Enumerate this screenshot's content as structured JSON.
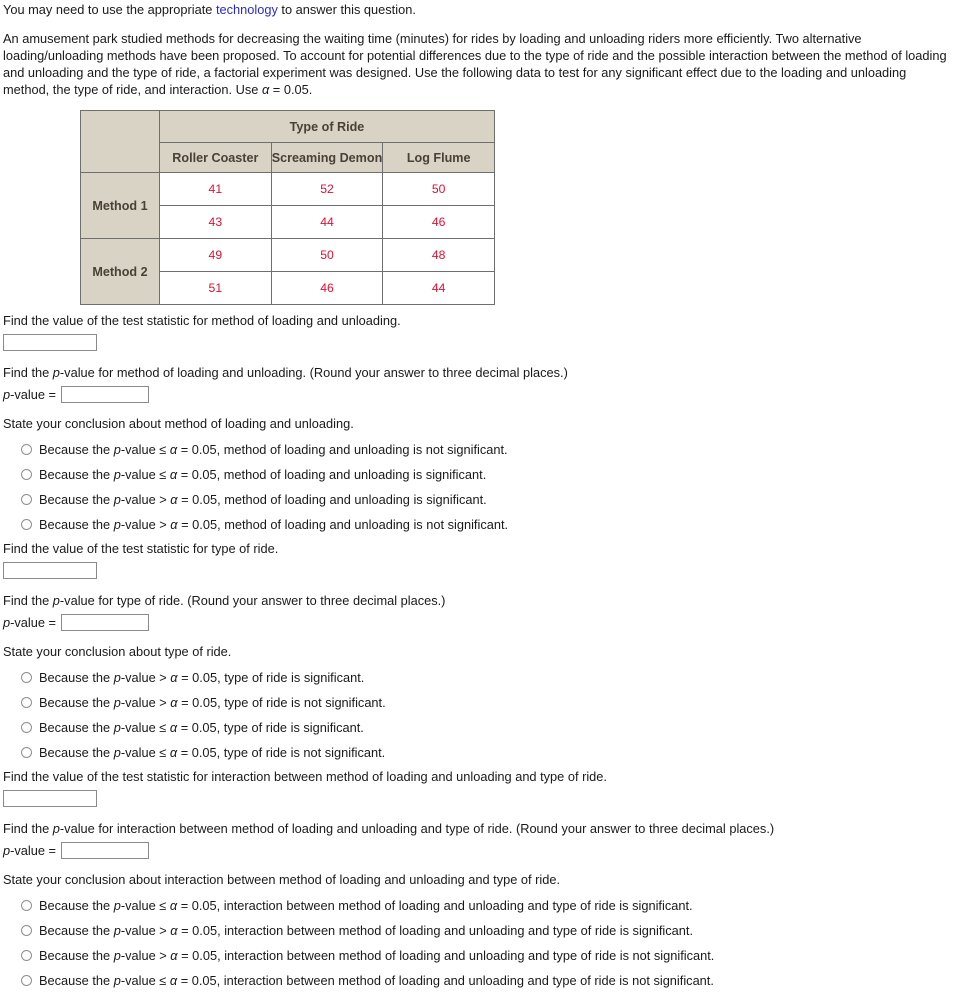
{
  "intro": {
    "prefix": "You may need to use the appropriate ",
    "link_label": "technology",
    "suffix": " to answer this question."
  },
  "problem": {
    "text": "An amusement park studied methods for decreasing the waiting time (minutes) for rides by loading and unloading riders more efficiently. Two alternative loading/unloading methods have been proposed. To account for potential differences due to the type of ride and the possible interaction between the method of loading and unloading and the type of ride, a factorial experiment was designed. Use the following data to test for any significant effect due to the loading and unloading method, the type of ride, and interaction. Use ",
    "alpha_symbol": "α",
    "alpha_statement": " = 0.05."
  },
  "table": {
    "corner_label": "",
    "group_header": "Type of Ride",
    "column_headers": [
      "Roller Coaster",
      "Screaming Demon",
      "Log Flume"
    ],
    "rows": [
      {
        "label": "Method 1",
        "values": [
          [
            "41",
            "52",
            "50"
          ],
          [
            "43",
            "44",
            "46"
          ]
        ]
      },
      {
        "label": "Method 2",
        "values": [
          [
            "49",
            "50",
            "48"
          ],
          [
            "51",
            "46",
            "44"
          ]
        ]
      }
    ]
  },
  "questions": [
    {
      "statistic_prompt": "Find the value of the test statistic for method of loading and unloading.",
      "statistic_value": "",
      "pvalue_prompt_a": "Find the ",
      "pvalue_prompt_p": "p",
      "pvalue_prompt_b": "-value for method of loading and unloading. (Round your answer to three decimal places.)",
      "pvalue_label_p": "p",
      "pvalue_label_rest": "-value =",
      "pvalue_value": "",
      "conclusion_prompt": "State your conclusion about method of loading and unloading.",
      "options": [
        {
          "pre": "Because the ",
          "p": "p",
          "mid": "-value ≤ ",
          "alpha": "α",
          "post": " = 0.05, method of loading and unloading is not significant."
        },
        {
          "pre": "Because the ",
          "p": "p",
          "mid": "-value ≤ ",
          "alpha": "α",
          "post": " = 0.05, method of loading and unloading is significant."
        },
        {
          "pre": "Because the ",
          "p": "p",
          "mid": "-value > ",
          "alpha": "α",
          "post": " = 0.05, method of loading and unloading is significant."
        },
        {
          "pre": "Because the ",
          "p": "p",
          "mid": "-value > ",
          "alpha": "α",
          "post": " = 0.05, method of loading and unloading is not significant."
        }
      ]
    },
    {
      "statistic_prompt": "Find the value of the test statistic for type of ride.",
      "statistic_value": "",
      "pvalue_prompt_a": "Find the ",
      "pvalue_prompt_p": "p",
      "pvalue_prompt_b": "-value for type of ride. (Round your answer to three decimal places.)",
      "pvalue_label_p": "p",
      "pvalue_label_rest": "-value =",
      "pvalue_value": "",
      "conclusion_prompt": "State your conclusion about type of ride.",
      "options": [
        {
          "pre": "Because the ",
          "p": "p",
          "mid": "-value > ",
          "alpha": "α",
          "post": " = 0.05, type of ride is significant."
        },
        {
          "pre": "Because the ",
          "p": "p",
          "mid": "-value > ",
          "alpha": "α",
          "post": " = 0.05, type of ride is not significant."
        },
        {
          "pre": "Because the ",
          "p": "p",
          "mid": "-value ≤ ",
          "alpha": "α",
          "post": " = 0.05, type of ride is significant."
        },
        {
          "pre": "Because the ",
          "p": "p",
          "mid": "-value ≤ ",
          "alpha": "α",
          "post": " = 0.05, type of ride is not significant."
        }
      ]
    },
    {
      "statistic_prompt": "Find the value of the test statistic for interaction between method of loading and unloading and type of ride.",
      "statistic_value": "",
      "pvalue_prompt_a": "Find the ",
      "pvalue_prompt_p": "p",
      "pvalue_prompt_b": "-value for interaction between method of loading and unloading and type of ride. (Round your answer to three decimal places.)",
      "pvalue_label_p": "p",
      "pvalue_label_rest": "-value =",
      "pvalue_value": "",
      "conclusion_prompt": "State your conclusion about interaction between method of loading and unloading and type of ride.",
      "options": [
        {
          "pre": "Because the ",
          "p": "p",
          "mid": "-value ≤ ",
          "alpha": "α",
          "post": " = 0.05, interaction between method of loading and unloading and type of ride is significant."
        },
        {
          "pre": "Because the ",
          "p": "p",
          "mid": "-value > ",
          "alpha": "α",
          "post": " = 0.05, interaction between method of loading and unloading and type of ride is significant."
        },
        {
          "pre": "Because the ",
          "p": "p",
          "mid": "-value > ",
          "alpha": "α",
          "post": " = 0.05, interaction between method of loading and unloading and type of ride is not significant."
        },
        {
          "pre": "Because the ",
          "p": "p",
          "mid": "-value ≤ ",
          "alpha": "α",
          "post": " = 0.05, interaction between method of loading and unloading and type of ride is not significant."
        }
      ]
    }
  ],
  "colors": {
    "link": "#2a2ad4",
    "table_header_bg": "#d8d3c5",
    "table_value_text": "#dd1133",
    "border": "#6f6f6f"
  }
}
